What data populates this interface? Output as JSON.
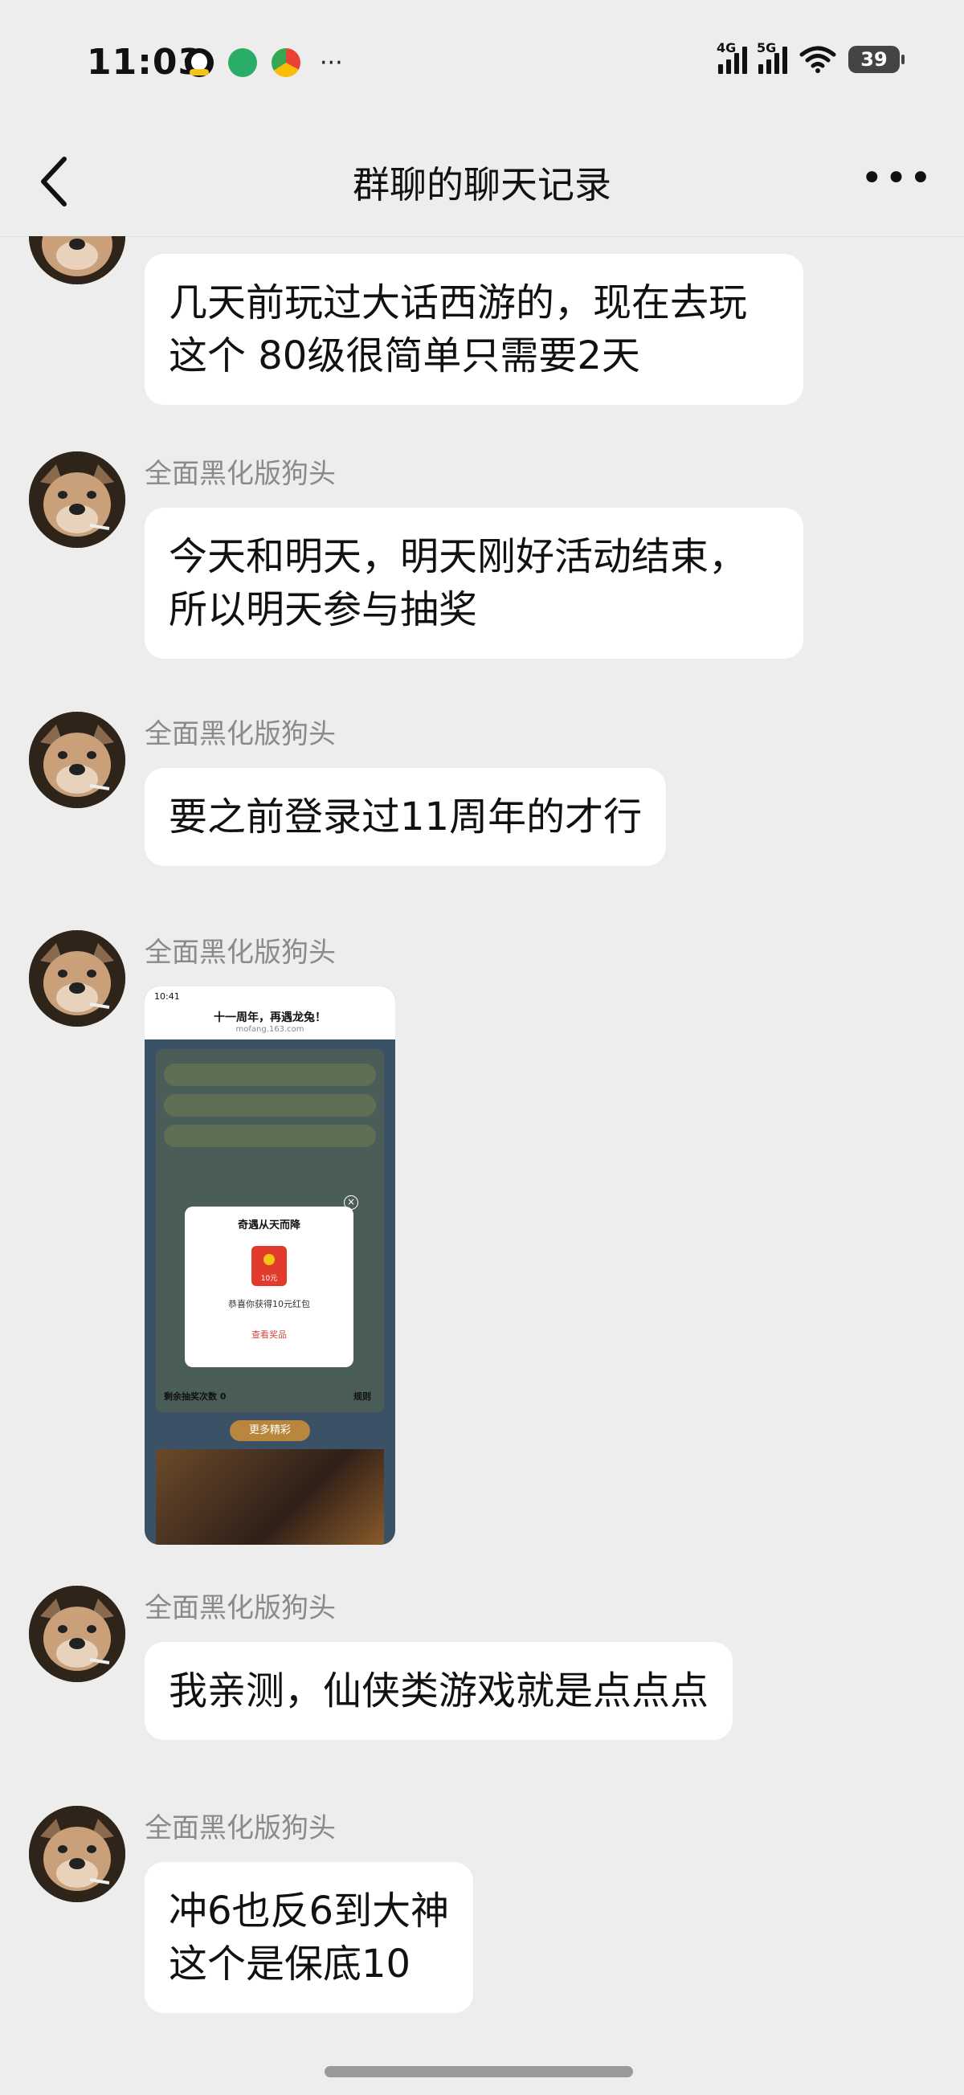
{
  "status": {
    "time": "11:03",
    "net1": "4G",
    "net2": "5G",
    "battery": "39",
    "overflow": "···"
  },
  "header": {
    "title": "群聊的聊天记录",
    "more": "•••"
  },
  "messages": [
    {
      "sender": "",
      "text": "几天前玩过大话西游的，现在去玩\n这个 80级很简单只需要2天"
    },
    {
      "sender": "全面黑化版狗头",
      "text": "今天和明天，明天刚好活动结束，\n所以明天参与抽奖"
    },
    {
      "sender": "全面黑化版狗头",
      "text": "要之前登录过11周年的才行"
    },
    {
      "sender": "全面黑化版狗头",
      "image": {
        "time": "10:41",
        "title": "十一周年，再遇龙兔！",
        "url": "mofang.163.com",
        "popup_title": "奇遇从天而降",
        "popup_amount": "10元",
        "popup_text": "恭喜你获得10元红包",
        "popup_link": "查看奖品",
        "remaining": "剩余抽奖次数 0",
        "rules": "规则",
        "section": "更多精彩"
      }
    },
    {
      "sender": "全面黑化版狗头",
      "text": "我亲测，仙侠类游戏就是点点点"
    },
    {
      "sender": "全面黑化版狗头",
      "text": "冲6也反6到大神\n这个是保底10"
    }
  ]
}
